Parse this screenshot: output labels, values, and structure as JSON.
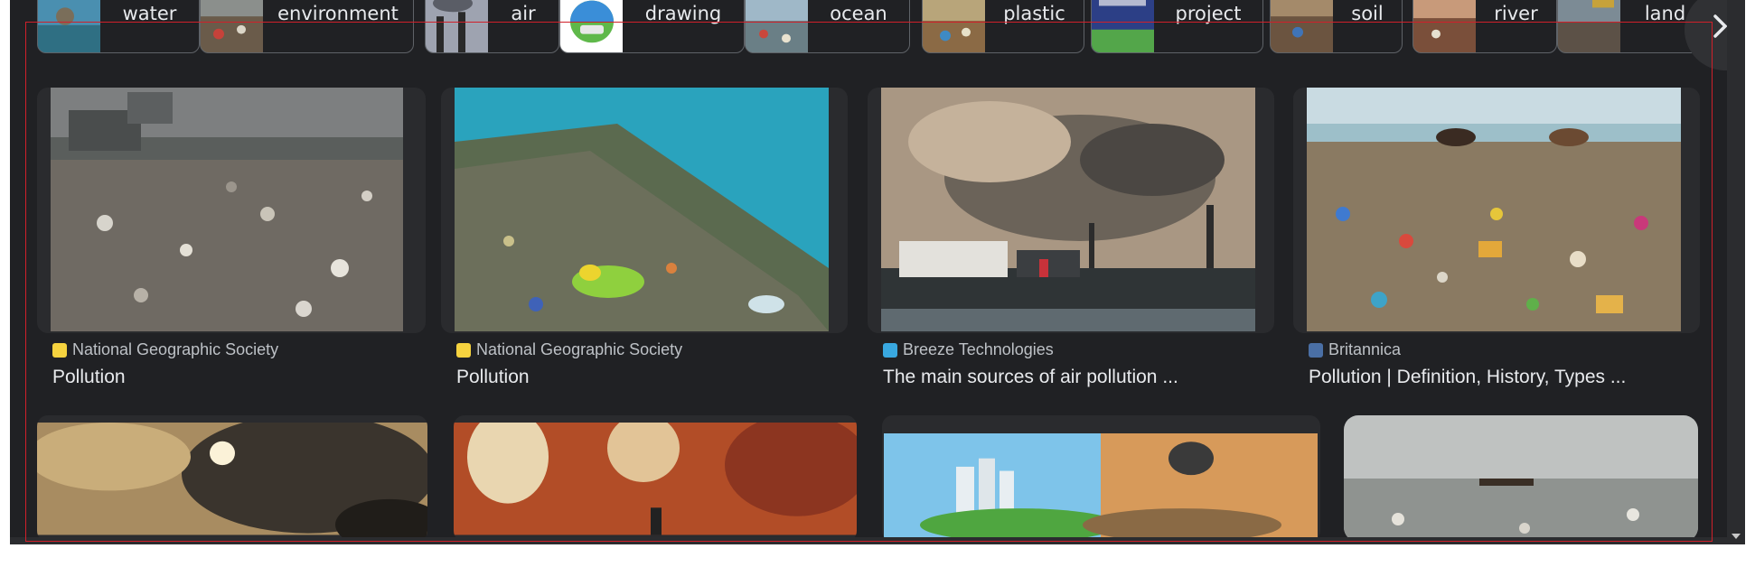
{
  "chips": [
    {
      "label": "water"
    },
    {
      "label": "environment"
    },
    {
      "label": "air"
    },
    {
      "label": "drawing"
    },
    {
      "label": "ocean"
    },
    {
      "label": "plastic"
    },
    {
      "label": "project"
    },
    {
      "label": "soil"
    },
    {
      "label": "river"
    },
    {
      "label": "land"
    }
  ],
  "results": [
    {
      "source": "National Geographic Society",
      "title": "Pollution",
      "favicon": "natgeo-icon"
    },
    {
      "source": "National Geographic Society",
      "title": "Pollution",
      "favicon": "natgeo-icon"
    },
    {
      "source": "Breeze Technologies",
      "title": "The main sources of air pollution ...",
      "favicon": "breeze-icon"
    },
    {
      "source": "Britannica",
      "title": "Pollution | Definition, History, Types ...",
      "favicon": "britannica-icon"
    }
  ],
  "colors": {
    "background": "#202124",
    "text": "#e8eaed",
    "muted_text": "#bdc1c6",
    "selection_frame": "#d0202a",
    "natgeo_favicon": "#f6d33f",
    "breeze_favicon": "#39a8e0",
    "britannica_favicon": "#4a6fa5"
  }
}
